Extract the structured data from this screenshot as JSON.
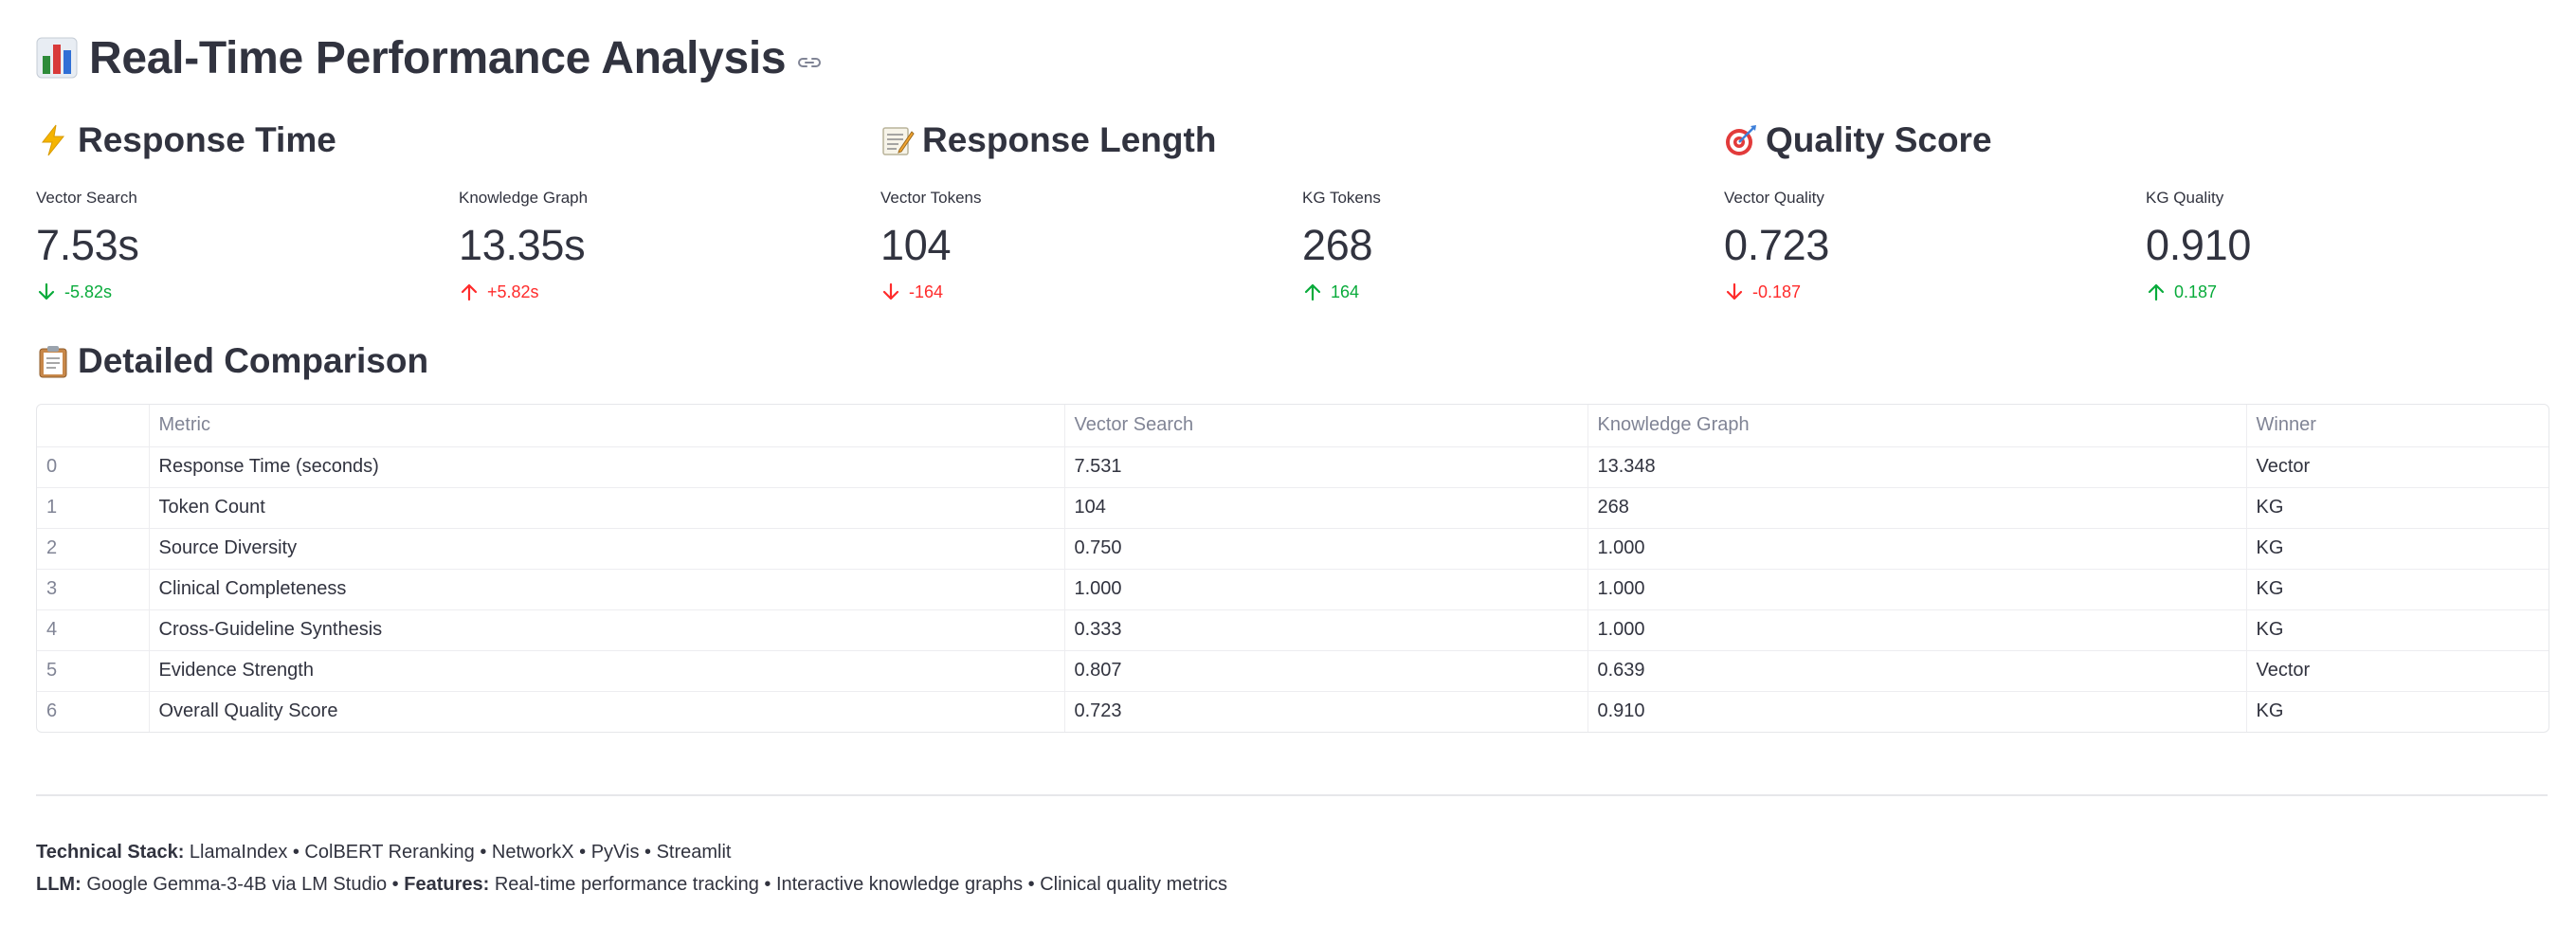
{
  "header": {
    "title": "Real-Time Performance Analysis",
    "title_icon": "bar-chart-icon",
    "link_icon": "link-icon"
  },
  "sections": {
    "response_time": {
      "title": "Response Time",
      "icon": "lightning-icon"
    },
    "response_length": {
      "title": "Response Length",
      "icon": "memo-icon"
    },
    "quality_score": {
      "title": "Quality Score",
      "icon": "target-icon"
    },
    "detailed": {
      "title": "Detailed Comparison",
      "icon": "clipboard-icon"
    }
  },
  "metrics": [
    {
      "label": "Vector Search",
      "value": "7.53s",
      "delta": "-5.82s",
      "direction": "down",
      "color": "#09ab3b"
    },
    {
      "label": "Knowledge Graph",
      "value": "13.35s",
      "delta": "+5.82s",
      "direction": "up",
      "color": "#ff2b2b"
    },
    {
      "label": "Vector Tokens",
      "value": "104",
      "delta": "-164",
      "direction": "down",
      "color": "#ff2b2b"
    },
    {
      "label": "KG Tokens",
      "value": "268",
      "delta": "164",
      "direction": "up",
      "color": "#09ab3b"
    },
    {
      "label": "Vector Quality",
      "value": "0.723",
      "delta": "-0.187",
      "direction": "down",
      "color": "#ff2b2b"
    },
    {
      "label": "KG Quality",
      "value": "0.910",
      "delta": "0.187",
      "direction": "up",
      "color": "#09ab3b"
    }
  ],
  "table": {
    "columns": [
      "",
      "Metric",
      "Vector Search",
      "Knowledge Graph",
      "Winner"
    ],
    "rows": [
      [
        "0",
        "Response Time (seconds)",
        "7.531",
        "13.348",
        "Vector"
      ],
      [
        "1",
        "Token Count",
        "104",
        "268",
        "KG"
      ],
      [
        "2",
        "Source Diversity",
        "0.750",
        "1.000",
        "KG"
      ],
      [
        "3",
        "Clinical Completeness",
        "1.000",
        "1.000",
        "KG"
      ],
      [
        "4",
        "Cross-Guideline Synthesis",
        "0.333",
        "1.000",
        "KG"
      ],
      [
        "5",
        "Evidence Strength",
        "0.807",
        "0.639",
        "Vector"
      ],
      [
        "6",
        "Overall Quality Score",
        "0.723",
        "0.910",
        "KG"
      ]
    ]
  },
  "footer": {
    "stack_label": "Technical Stack:",
    "stack_text": " LlamaIndex • ColBERT Reranking • NetworkX • PyVis • Streamlit",
    "llm_label": "LLM:",
    "llm_text": " Google Gemma-3-4B via LM Studio • ",
    "features_label": "Features:",
    "features_text": " Real-time performance tracking • Interactive knowledge graphs • Clinical quality metrics"
  },
  "colors": {
    "positive": "#09ab3b",
    "negative": "#ff2b2b",
    "text": "#31333f",
    "muted": "#808495"
  }
}
